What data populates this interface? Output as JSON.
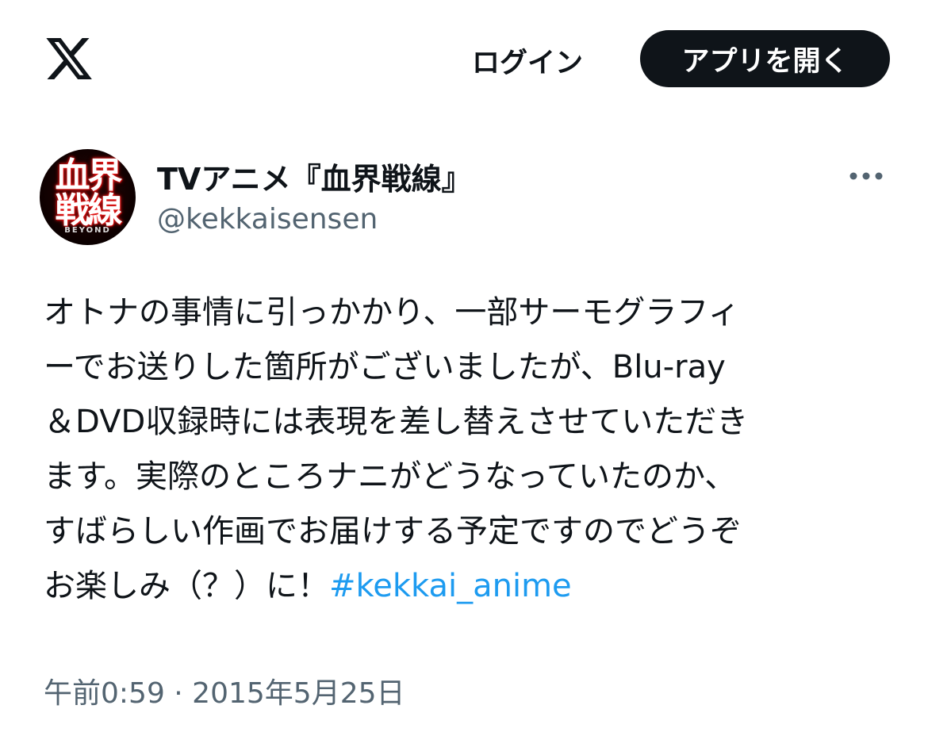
{
  "header": {
    "logo_icon": "x-logo-icon",
    "login_label": "ログイン",
    "open_app_label": "アプリを開く"
  },
  "tweet": {
    "author": {
      "display_name": "TVアニメ『血界戦線』",
      "handle": "@kekkaisensen",
      "avatar_text_top": "血界",
      "avatar_text_bottom": "戦線",
      "avatar_text_sub": "BEYOND"
    },
    "more_icon": "more-horizontal-icon",
    "lines": [
      "オトナの事情に引っかかり、一部サーモグラフィ",
      "ーでお送りした箇所がございましたが、Blu-ray",
      "＆DVD収録時には表現を差し替えさせていただき",
      "ます。実際のところナニがどうなっていたのか、",
      "すばらしい作画でお届けする予定ですのでどうぞ"
    ],
    "last_line_text": "お楽しみ（？）に！",
    "hashtag": "#kekkai_anime",
    "timestamp": "午前0:59 · 2015年5月25日"
  },
  "colors": {
    "text_primary": "#0f1419",
    "text_secondary": "#536471",
    "link": "#1d9bf0",
    "button_bg": "#0f1419"
  }
}
